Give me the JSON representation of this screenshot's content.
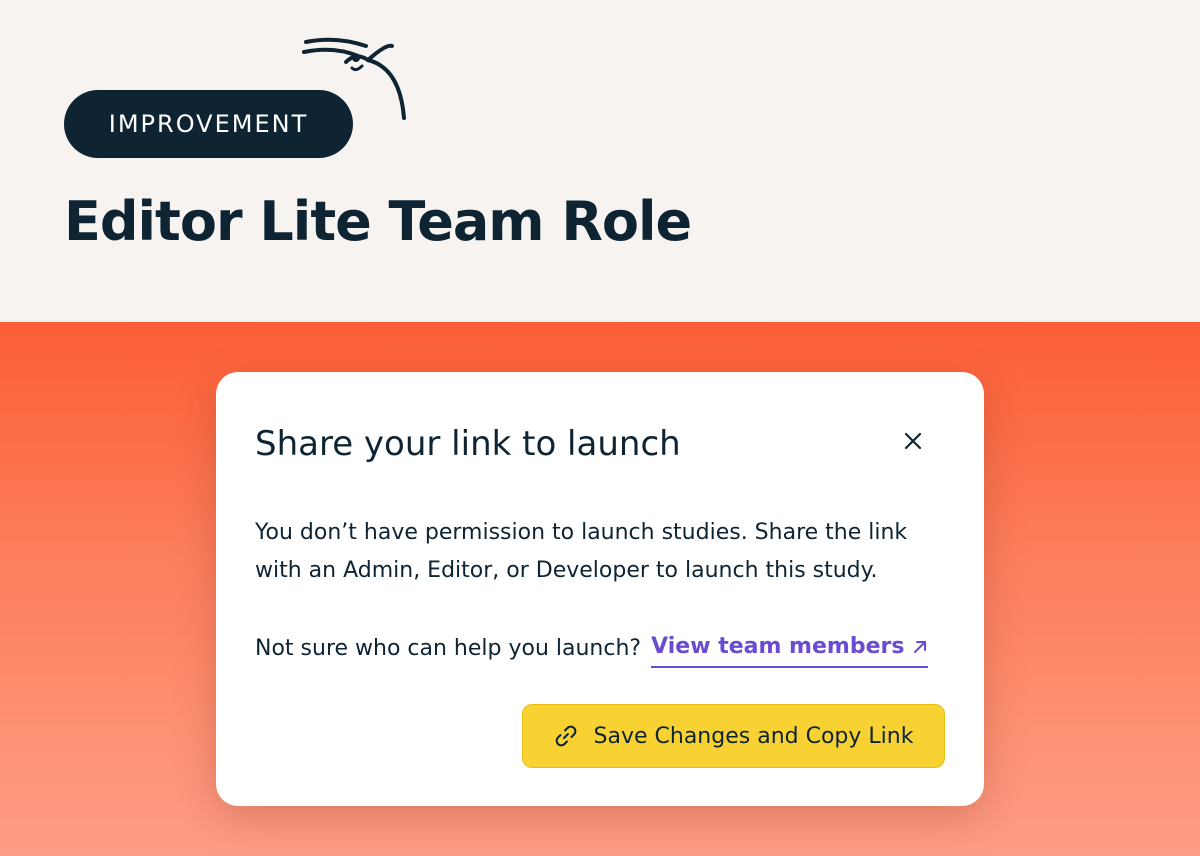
{
  "hero": {
    "badge_label": "IMPROVEMENT",
    "title": "Editor Lite Team Role",
    "doodle_icon": "bird-doodle-icon"
  },
  "dialog": {
    "title": "Share your link to launch",
    "close_icon": "close-icon",
    "body": "You don’t have permission to launch studies. Share the link with an Admin, Editor, or Developer to launch this study.",
    "help_prompt": "Not sure who can help you launch?",
    "team_link_label": "View team members",
    "team_link_icon": "external-arrow-icon",
    "primary_button_label": "Save Changes and Copy Link",
    "primary_button_icon": "link-icon"
  },
  "colors": {
    "hero_bg": "#f7f3f0",
    "navy": "#0f2433",
    "orange_top": "#fb5e36",
    "orange_bottom": "#fe9d85",
    "link_purple": "#6a4bd1",
    "button_yellow": "#f8d232"
  }
}
